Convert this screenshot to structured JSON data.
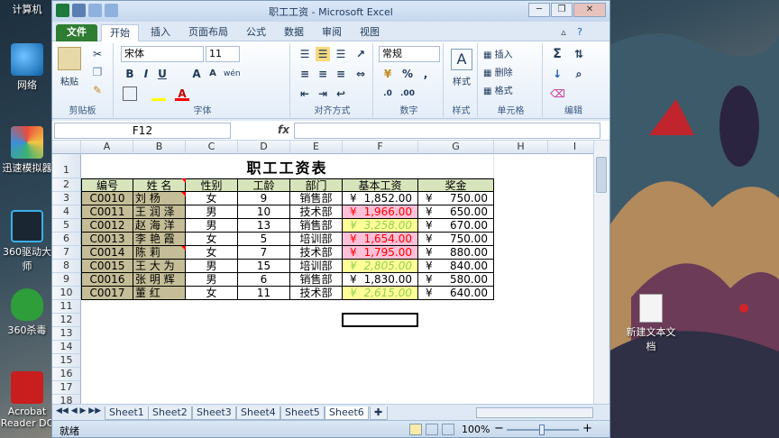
{
  "desktop": {
    "icons": [
      {
        "label": "计算机"
      },
      {
        "label": "网络"
      },
      {
        "label": "迅速模拟器"
      },
      {
        "label": "360驱动大师"
      },
      {
        "label": "360杀毒"
      },
      {
        "label": "Acrobat Reader DC"
      },
      {
        "label": "新建文本文档"
      }
    ]
  },
  "window": {
    "title": "职工工资 - Microsoft Excel",
    "buttons": {
      "minimize": "─",
      "restore": "❐",
      "close": "✕"
    }
  },
  "ribbon": {
    "tabs": [
      "文件",
      "开始",
      "插入",
      "页面布局",
      "公式",
      "数据",
      "审阅",
      "视图"
    ],
    "active_tab": "开始",
    "clipboard": {
      "paste": "粘贴",
      "label": "剪贴板"
    },
    "font": {
      "name": "宋体",
      "size": "11",
      "bold": "B",
      "italic": "I",
      "underline": "U",
      "grow": "A",
      "label": "字体",
      "wen": "wén"
    },
    "alignment": {
      "label": "对齐方式"
    },
    "number": {
      "format": "常规",
      "percent": "%",
      "comma": ",",
      "label": "数字"
    },
    "styles": {
      "label": "样式",
      "btn": "样式"
    },
    "cells": {
      "insert": "插入",
      "delete": "删除",
      "format": "格式",
      "label": "单元格"
    },
    "editing": {
      "sum": "Σ",
      "label": "编辑"
    }
  },
  "formula_bar": {
    "name_box": "F12",
    "fx": "fx",
    "value": ""
  },
  "grid": {
    "columns": [
      "A",
      "B",
      "C",
      "D",
      "E",
      "F",
      "G",
      "H",
      "I"
    ],
    "rows": [
      "1",
      "2",
      "3",
      "4",
      "5",
      "6",
      "7",
      "8",
      "9",
      "10",
      "11",
      "12",
      "13",
      "14",
      "15",
      "16",
      "17",
      "18"
    ],
    "title": "职工工资表",
    "headers": [
      "编号",
      "姓   名",
      "性别",
      "工龄",
      "部门",
      "基本工资",
      "奖金"
    ],
    "records": [
      {
        "id": "C0010",
        "name": "刘    杨",
        "sex": "女",
        "years": "9",
        "dept": "销售部",
        "salary": "1,852.00",
        "bonus": "750.00"
      },
      {
        "id": "C0011",
        "name": "王  润  泽",
        "sex": "男",
        "years": "10",
        "dept": "技术部",
        "salary": "1,966.00",
        "bonus": "650.00"
      },
      {
        "id": "C0012",
        "name": "赵  海  洋",
        "sex": "男",
        "years": "13",
        "dept": "销售部",
        "salary": "3,258.00",
        "bonus": "670.00"
      },
      {
        "id": "C0013",
        "name": "李  艳  霞",
        "sex": "女",
        "years": "5",
        "dept": "培训部",
        "salary": "1,654.00",
        "bonus": "750.00"
      },
      {
        "id": "C0014",
        "name": "陈    莉",
        "sex": "女",
        "years": "7",
        "dept": "技术部",
        "salary": "1,795.00",
        "bonus": "880.00"
      },
      {
        "id": "C0015",
        "name": "王  大  为",
        "sex": "男",
        "years": "15",
        "dept": "培训部",
        "salary": "2,805.00",
        "bonus": "840.00"
      },
      {
        "id": "C0016",
        "name": "张  明  辉",
        "sex": "男",
        "years": "6",
        "dept": "销售部",
        "salary": "1,830.00",
        "bonus": "580.00"
      },
      {
        "id": "C0017",
        "name": "董    红",
        "sex": "女",
        "years": "11",
        "dept": "技术部",
        "salary": "2,615.00",
        "bonus": "640.00"
      }
    ],
    "currency": "¥",
    "colors": {
      "header_fill": "#d8e4bc",
      "id_name_fill": "#c4bd97",
      "pink_fill": "#ffc0d8",
      "yellow_fill": "#ffff99",
      "red_text": "#ff0000",
      "green_text": "#92d050"
    }
  },
  "sheet_tabs": [
    "Sheet1",
    "Sheet2",
    "Sheet3",
    "Sheet4",
    "Sheet5",
    "Sheet6"
  ],
  "active_sheet": "Sheet6",
  "status": {
    "ready": "就绪",
    "zoom": "100%",
    "zoom_out": "−",
    "zoom_in": "+"
  }
}
